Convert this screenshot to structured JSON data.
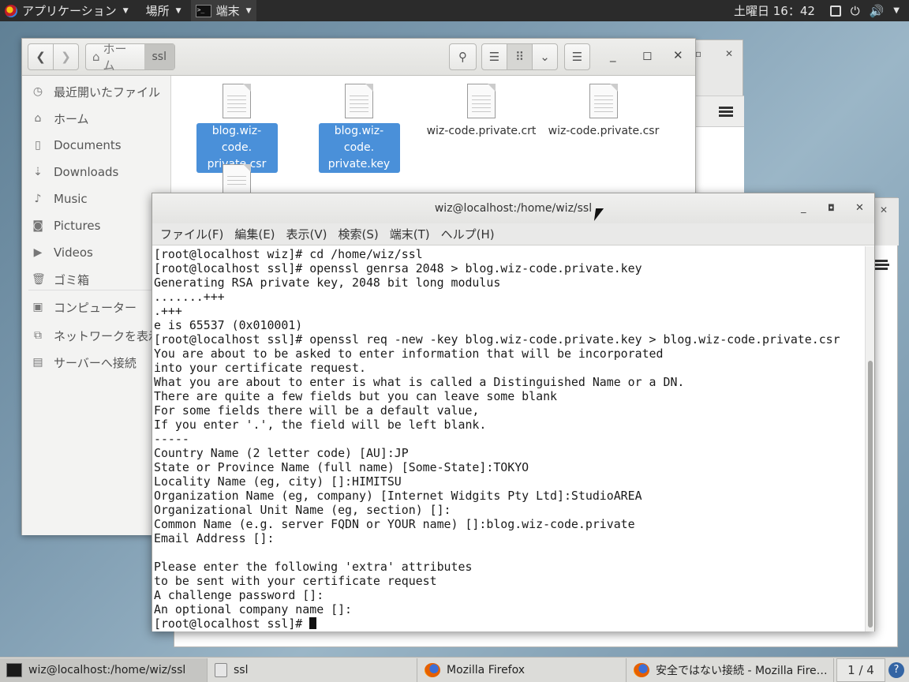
{
  "top_panel": {
    "applications": "アプリケーション",
    "places": "場所",
    "terminal": "端末",
    "clock": "土曜日 16：42",
    "icons": [
      "display-icon",
      "volume-icon",
      "power-icon",
      "chevron-down-icon"
    ]
  },
  "file_manager": {
    "path": {
      "home": "ホーム",
      "current": "ssl"
    },
    "sidebar": [
      {
        "label": "最近開いたファイル",
        "icon": "clock-icon"
      },
      {
        "label": "ホーム",
        "icon": "home-icon"
      },
      {
        "label": "Documents",
        "icon": "document-icon"
      },
      {
        "label": "Downloads",
        "icon": "download-icon"
      },
      {
        "label": "Music",
        "icon": "music-icon"
      },
      {
        "label": "Pictures",
        "icon": "camera-icon"
      },
      {
        "label": "Videos",
        "icon": "video-icon"
      },
      {
        "label": "ゴミ箱",
        "icon": "trash-icon"
      },
      {
        "label": "コンピューター",
        "icon": "computer-icon"
      },
      {
        "label": "ネットワークを表示",
        "icon": "network-icon"
      },
      {
        "label": "サーバーへ接続",
        "icon": "server-icon"
      }
    ],
    "files": [
      {
        "name_l1": "blog.wiz-code.",
        "name_l2": "private.csr",
        "selected": true
      },
      {
        "name_l1": "blog.wiz-code.",
        "name_l2": "private.key",
        "selected": true
      },
      {
        "name_l1": "wiz-code.private.crt",
        "name_l2": "",
        "selected": false
      },
      {
        "name_l1": "wiz-code.private.csr",
        "name_l2": "",
        "selected": false
      }
    ]
  },
  "terminal": {
    "title": "wiz@localhost:/home/wiz/ssl",
    "menu": [
      "ファイル(F)",
      "編集(E)",
      "表示(V)",
      "検索(S)",
      "端末(T)",
      "ヘルプ(H)"
    ],
    "lines": [
      "[root@localhost wiz]# cd /home/wiz/ssl",
      "[root@localhost ssl]# openssl genrsa 2048 > blog.wiz-code.private.key",
      "Generating RSA private key, 2048 bit long modulus",
      ".......+++",
      ".+++",
      "e is 65537 (0x010001)",
      "[root@localhost ssl]# openssl req -new -key blog.wiz-code.private.key > blog.wiz-code.private.csr",
      "You are about to be asked to enter information that will be incorporated",
      "into your certificate request.",
      "What you are about to enter is what is called a Distinguished Name or a DN.",
      "There are quite a few fields but you can leave some blank",
      "For some fields there will be a default value,",
      "If you enter '.', the field will be left blank.",
      "-----",
      "Country Name (2 letter code) [AU]:JP",
      "State or Province Name (full name) [Some-State]:TOKYO",
      "Locality Name (eg, city) []:HIMITSU",
      "Organization Name (eg, company) [Internet Widgits Pty Ltd]:StudioAREA",
      "Organizational Unit Name (eg, section) []:",
      "Common Name (e.g. server FQDN or YOUR name) []:blog.wiz-code.private",
      "Email Address []:",
      "",
      "Please enter the following 'extra' attributes",
      "to be sent with your certificate request",
      "A challenge password []:",
      "An optional company name []:"
    ],
    "prompt": "[root@localhost ssl]# "
  },
  "taskbar": {
    "tasks": [
      {
        "label": "wiz@localhost:/home/wiz/ssl",
        "icon": "terminal-icon",
        "active": true
      },
      {
        "label": "ssl",
        "icon": "files-icon",
        "active": false
      },
      {
        "label": "Mozilla Firefox",
        "icon": "firefox-icon",
        "active": false
      },
      {
        "label": "安全ではない接続 - Mozilla Fire…",
        "icon": "firefox-icon",
        "active": false
      }
    ],
    "pager": "1 / 4",
    "help": "?"
  }
}
